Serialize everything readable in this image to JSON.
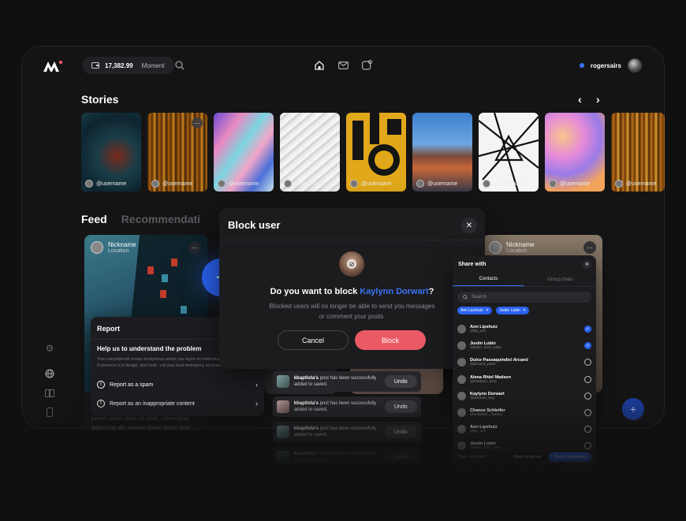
{
  "topbar": {
    "balance": "17,382.99",
    "balance_label": "Moment",
    "username": "rogersairs"
  },
  "stories": {
    "title": "Stories",
    "prev": "‹",
    "next": "›",
    "items": [
      {
        "user": "@username"
      },
      {
        "user": "@username"
      },
      {
        "user": "@username"
      },
      {
        "user": "@username"
      },
      {
        "user": "@username"
      },
      {
        "user": "@username"
      },
      {
        "user": "@username"
      },
      {
        "user": "@username"
      },
      {
        "user": "@username"
      }
    ]
  },
  "feed": {
    "tab_feed": "Feed",
    "tab_recommendations": "Recommendati",
    "cards": [
      {
        "nickname": "Nickname",
        "location": "Location",
        "text": "Lorem ipsum dolor sit amet, consectetur adipiscing elit. Aenean lorem ipsum ame..."
      },
      {
        "nickname": "Nickname",
        "location": "Location"
      }
    ]
  },
  "report": {
    "title": "Report",
    "question": "Help us to understand the problem",
    "description": "Your complaint will remain anonymous unless you report an intellectual property infringement. If someone is in danger, don't wait - call your local emergency services.",
    "options": [
      "Report as a spam",
      "Report as an inappropriate content"
    ]
  },
  "block": {
    "title": "Block user",
    "question_prefix": "Do you want to block ",
    "question_name": "Kaylynn Dorwart",
    "question_suffix": "?",
    "description": "Blocked users will no longer be able to send you messages or comment your posts.",
    "cancel": "Cancel",
    "confirm": "Block"
  },
  "toasts": [
    {
      "user": "kbaptista's",
      "msg": " post has been successfully added to saved.",
      "action": "Undo"
    },
    {
      "user": "kbaptista's",
      "msg": " post has been successfully added to saved.",
      "action": "Undo"
    },
    {
      "user": "kbaptista's",
      "msg": " post has been successfully added to saved.",
      "action": "Undo"
    },
    {
      "user": "kbaptista's",
      "msg": " post has been successfully added to saved.",
      "action": "Undo"
    }
  ],
  "share": {
    "title": "Share with",
    "tab_contacts": "Contacts",
    "tab_group": "Group chats",
    "search_placeholder": "Search",
    "chips": [
      "Ann Lipshutz",
      "Justin Lubin"
    ],
    "contacts": [
      {
        "name": "Ann Lipshutz",
        "handle": "@lip_ann",
        "checked": true
      },
      {
        "name": "Justin Lubin",
        "handle": "@lubin_from_lubin",
        "checked": true
      },
      {
        "name": "Dulce Passaquindici Arcand",
        "handle": "@arcand_pass",
        "checked": false
      },
      {
        "name": "Alena Rhiel Madsen",
        "handle": "@madsen_lena",
        "checked": false
      },
      {
        "name": "Kaylynn Dorwart",
        "handle": "@dorwart_kay",
        "checked": false
      },
      {
        "name": "Chance Schleifer",
        "handle": "@schleifer_chance",
        "checked": false
      },
      {
        "name": "Ann Lipshutz",
        "handle": "@lip_ann",
        "checked": false
      },
      {
        "name": "Justin Lubin",
        "handle": "@lubin_from_lubin",
        "checked": false
      }
    ],
    "clear": "Clear selection",
    "share_group": "Share in group",
    "share_sep": "Share separately"
  }
}
